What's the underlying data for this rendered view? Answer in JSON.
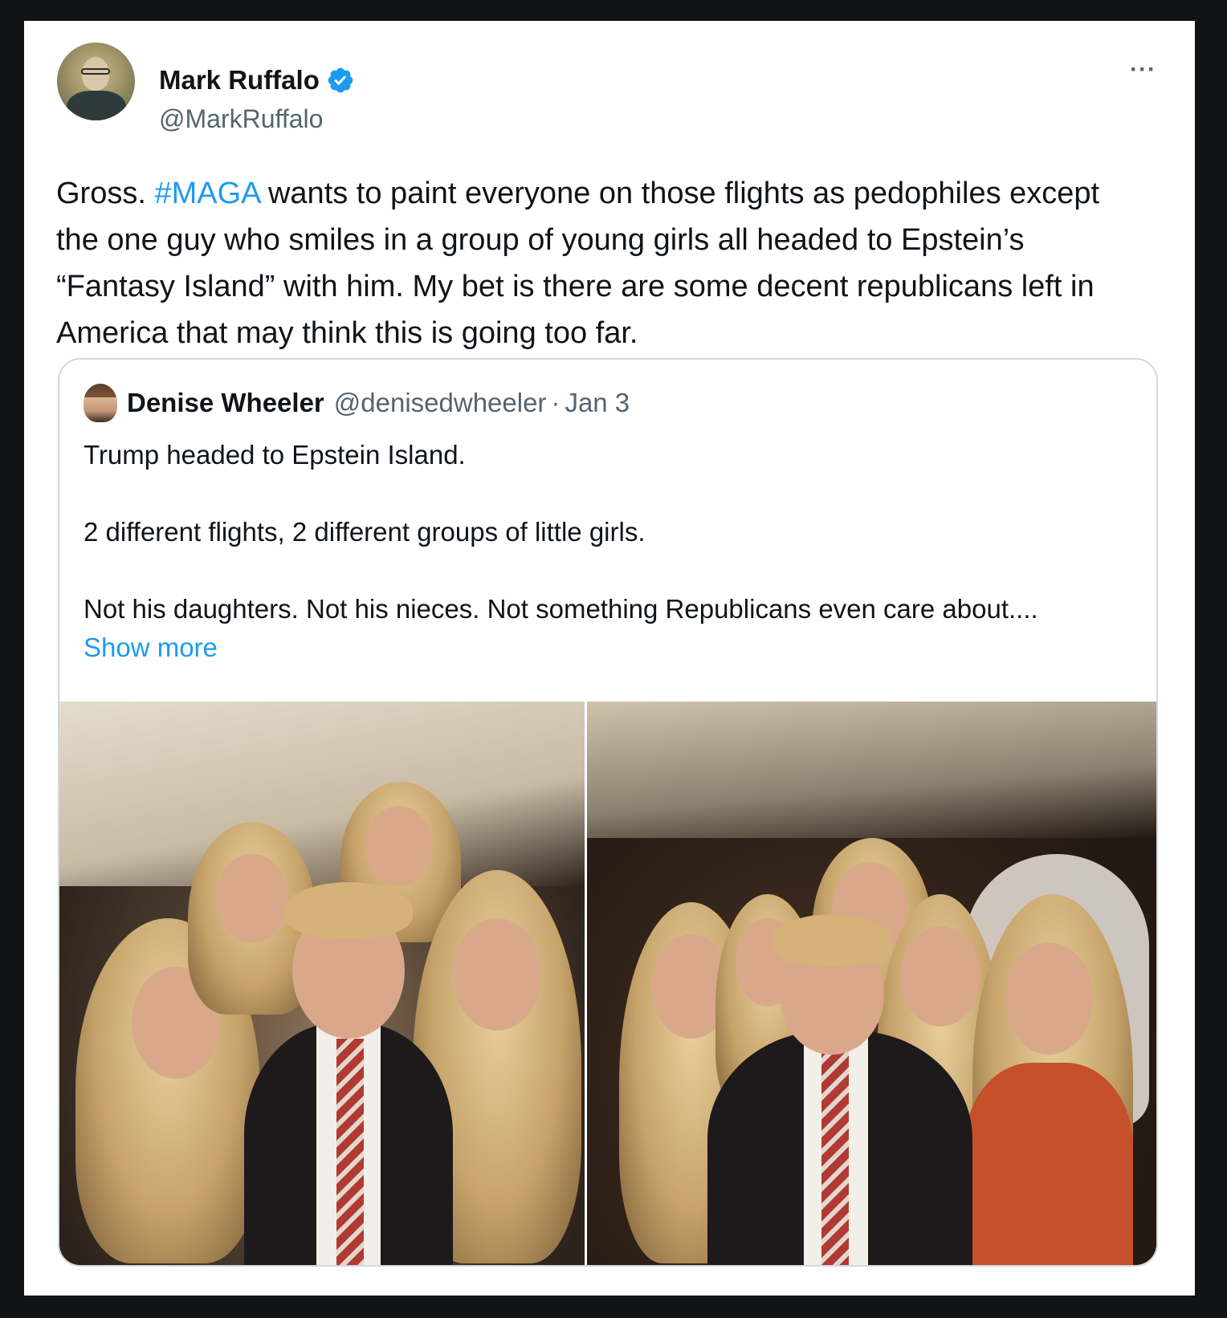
{
  "tweet": {
    "display_name": "Mark Ruffalo",
    "handle": "@MarkRuffalo",
    "more_label": "···",
    "text_before": "Gross. ",
    "hashtag": "#MAGA",
    "text_after": " wants to paint everyone on those flights as pedophiles except the one guy who smiles in a group of young girls all headed to Epstein’s “Fantasy Island” with him. My bet is there are some decent republicans left in America that may think this is going too far."
  },
  "quote": {
    "display_name": "Denise Wheeler",
    "handle": "@denisedwheeler",
    "separator": "·",
    "date": "Jan 3",
    "lines": [
      "Trump headed to Epstein Island.",
      "2 different flights, 2 different groups of little girls.",
      "Not his daughters. Not his nieces. Not something Republicans even care about...."
    ],
    "show_more": "Show more"
  },
  "colors": {
    "accent": "#1d9bf0",
    "text": "#0f1419",
    "secondary": "#536471",
    "border": "#cfd9de"
  }
}
